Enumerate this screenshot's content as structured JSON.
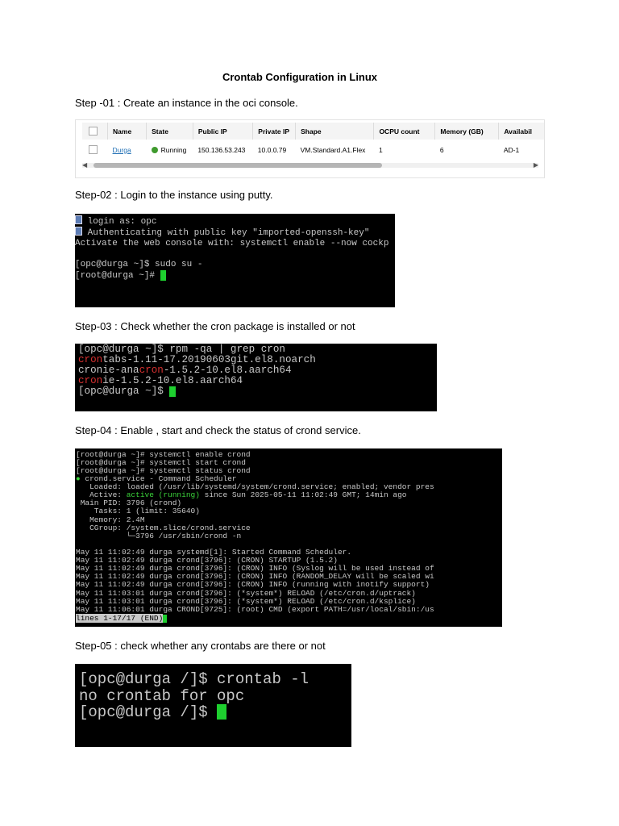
{
  "doc": {
    "title": "Crontab Configuration in Linux",
    "step1": "Step -01 : Create an instance in the oci console.",
    "step2": "Step-02 : Login  to the instance using putty.",
    "step3": "Step-03 : Check whether the cron package is installed or not",
    "step4": "Step-04 : Enable , start and check the status of crond service.",
    "step5": "Step-05 : check whether any crontabs are there  or not"
  },
  "oci_table": {
    "headers": [
      "Name",
      "State",
      "Public IP",
      "Private IP",
      "Shape",
      "OCPU count",
      "Memory (GB)",
      "Availabil"
    ],
    "row": {
      "name": "Durga",
      "state": "Running",
      "public_ip": "150.136.53.243",
      "private_ip": "10.0.0.79",
      "shape": "VM.Standard.A1.Flex",
      "ocpu": "1",
      "memory": "6",
      "availability": "AD-1"
    },
    "state_color": "#3f9a2e",
    "scroll_left_icon": "chevron-left-icon",
    "scroll_right_icon": "chevron-right-icon"
  },
  "term1": {
    "lines": [
      "login as: opc",
      "Authenticating with public key \"imported-openssh-key\"",
      "Activate the web console with: systemctl enable --now cockp",
      "",
      "[opc@durga ~]$ sudo su -",
      "[root@durga ~]# "
    ]
  },
  "term2": {
    "l1": "[opc@durga ~]$ rpm -qa | grep cron",
    "l2a": "cron",
    "l2b": "tabs-1.11-17.20190603git.el8.noarch",
    "l3a": "cronie-ana",
    "l3b": "cron",
    "l3c": "-1.5.2-10.el8.aarch64",
    "l4a": "cron",
    "l4b": "ie-1.5.2-10.el8.aarch64",
    "l5": "[opc@durga ~]$ "
  },
  "term3": {
    "lines": [
      "[root@durga ~]# systemctl enable crond",
      "[root@durga ~]# systemctl start crond",
      "[root@durga ~]# systemctl status crond"
    ],
    "svc": "crond.service - Command Scheduler",
    "loaded": "   Loaded: loaded (/usr/lib/systemd/system/crond.service; enabled; vendor pres",
    "active_pre": "   Active: ",
    "active_status": "active (running)",
    "active_post": " since Sun 2025-05-11 11:02:49 GMT; 14min ago",
    "rest": [
      " Main PID: 3796 (crond)",
      "    Tasks: 1 (limit: 35640)",
      "   Memory: 2.4M",
      "   CGroup: /system.slice/crond.service",
      "           └─3796 /usr/sbin/crond -n",
      "",
      "May 11 11:02:49 durga systemd[1]: Started Command Scheduler.",
      "May 11 11:02:49 durga crond[3796]: (CRON) STARTUP (1.5.2)",
      "May 11 11:02:49 durga crond[3796]: (CRON) INFO (Syslog will be used instead of",
      "May 11 11:02:49 durga crond[3796]: (CRON) INFO (RANDOM_DELAY will be scaled wi",
      "May 11 11:02:49 durga crond[3796]: (CRON) INFO (running with inotify support)",
      "May 11 11:03:01 durga crond[3796]: (*system*) RELOAD (/etc/cron.d/uptrack)",
      "May 11 11:03:01 durga crond[3796]: (*system*) RELOAD (/etc/cron.d/ksplice)",
      "May 11 11:06:01 durga CROND[9725]: (root) CMD (export PATH=/usr/local/sbin:/us"
    ],
    "status_line": "lines 1-17/17 (END)"
  },
  "term4": {
    "lines": [
      "[opc@durga /]$ crontab -l",
      "no crontab for opc",
      "[opc@durga /]$ "
    ]
  },
  "colors": {
    "terminal_bg": "#000000",
    "terminal_text": "#c8c8c8",
    "highlight_red": "#d63030",
    "active_green": "#3ad33a",
    "cursor_green": "#1ed02f"
  }
}
